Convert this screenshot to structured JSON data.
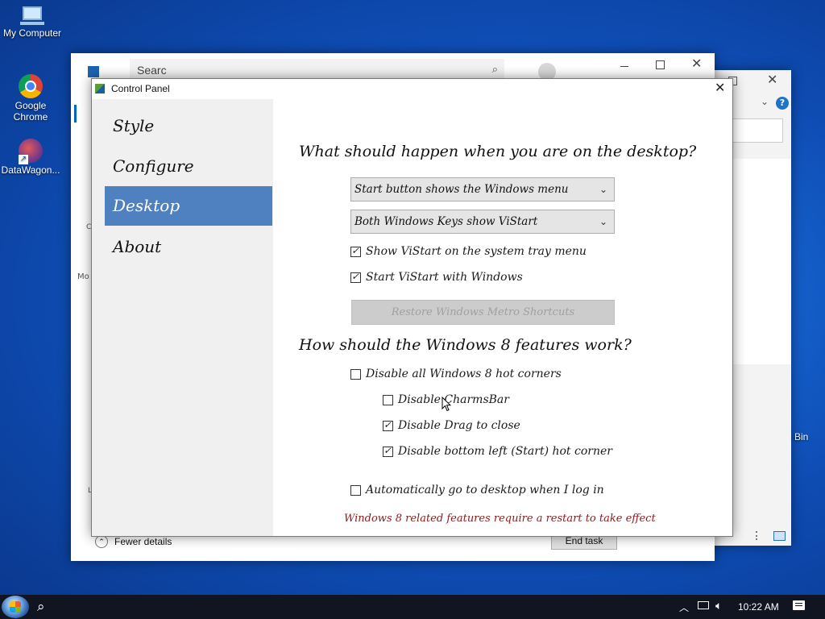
{
  "desktop": {
    "icons": [
      {
        "label": "My Computer",
        "icon": "computer-icon"
      },
      {
        "label": "Google\nChrome",
        "icon": "chrome-icon"
      },
      {
        "label": "DataWagon...",
        "icon": "datawagon-shortcut-icon"
      }
    ],
    "recycle_bin_label": "e Bin"
  },
  "task_manager": {
    "search_placeholder": "Searc",
    "fewer_details": "Fewer details",
    "end_task": "End task",
    "side_label_1": "C",
    "side_label_2": "Mo",
    "side_label_3": "L"
  },
  "control_panel": {
    "title": "Control Panel",
    "nav": [
      "Style",
      "Configure",
      "Desktop",
      "About"
    ],
    "active_nav": "Desktop",
    "heading_desktop": "What should happen when you are on the desktop?",
    "start_button_dropdown": "Start button shows the Windows menu",
    "windows_keys_dropdown": "Both Windows Keys show ViStart",
    "show_tray_menu": {
      "label": "Show ViStart on the system tray menu",
      "checked": true
    },
    "start_with_windows": {
      "label": "Start ViStart with Windows",
      "checked": true
    },
    "restore_button": "Restore Windows Metro Shortcuts",
    "heading_win8": "How should the Windows 8 features work?",
    "disable_hot_corners": {
      "label": "Disable all Windows 8 hot corners",
      "checked": false
    },
    "disable_charmsbar": {
      "label": "Disable CharmsBar",
      "checked": false
    },
    "disable_drag_close": {
      "label": "Disable Drag to close",
      "checked": true
    },
    "disable_start_corner": {
      "label": "Disable bottom left (Start) hot corner",
      "checked": true
    },
    "auto_desktop": {
      "label": "Automatically go to desktop when I log in",
      "checked": false
    },
    "restart_notice": "Windows 8 related features require a restart to take effect",
    "notice_color": "#8b1a1a"
  },
  "taskbar": {
    "time": "10:22 AM"
  },
  "colors": {
    "accent": "#4f81c0",
    "taskbar": "#101521"
  }
}
